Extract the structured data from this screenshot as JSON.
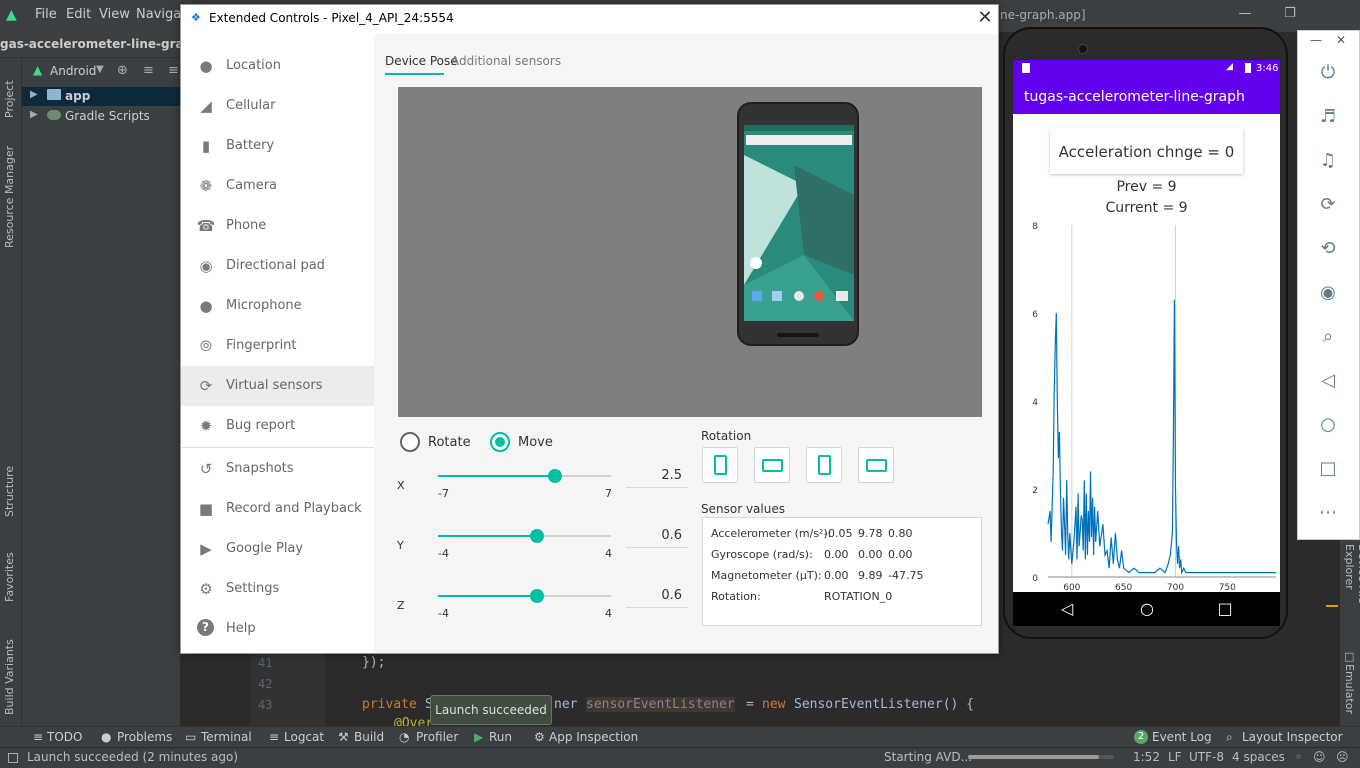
{
  "ide": {
    "menu": [
      "File",
      "Edit",
      "View",
      "Navigate"
    ],
    "title_right": "ne-graph.app]",
    "nav_title": "gas-accelerometer-line-graph",
    "project_view": "Android",
    "tree": [
      "app",
      "Gradle Scripts"
    ],
    "left_tabs": [
      "Project",
      "Resource Manager",
      "Structure",
      "Favorites",
      "Build Variants"
    ],
    "right_tabs": [
      "Device File Explorer",
      "Emulator"
    ],
    "line_numbers": [
      "41",
      "42",
      "43"
    ],
    "code": {
      "line41": "});",
      "line43_kw": "private",
      "line43_s": "S",
      "line43_type_rest": "ner",
      "line43_var": "sensorEventListener",
      "line43_eq": "=",
      "line43_new": "new",
      "line43_rest": "SensorEventListener() {",
      "line44": "@Over"
    },
    "bottom_tools": [
      "TODO",
      "Problems",
      "Terminal",
      "Logcat",
      "Build",
      "Profiler",
      "Run",
      "App Inspection"
    ],
    "bottom_right_tools": [
      "Event Log",
      "Layout Inspector"
    ],
    "event_log_count": "2",
    "tooltip": "Launch succeeded",
    "status_left": "Launch succeeded (2 minutes ago)",
    "status_starting": "Starting AVD...",
    "status_progress": 0.9,
    "status_position": "1:52",
    "status_line_sep": "LF",
    "status_encoding": "UTF-8",
    "status_indent": "4 spaces"
  },
  "extended_controls": {
    "title": "Extended Controls - Pixel_4_API_24:5554",
    "sidebar": [
      {
        "label": "Location",
        "icon": "location-pin-icon"
      },
      {
        "label": "Cellular",
        "icon": "signal-icon"
      },
      {
        "label": "Battery",
        "icon": "battery-icon"
      },
      {
        "label": "Camera",
        "icon": "camera-aperture-icon"
      },
      {
        "label": "Phone",
        "icon": "phone-icon"
      },
      {
        "label": "Directional pad",
        "icon": "dpad-icon"
      },
      {
        "label": "Microphone",
        "icon": "microphone-icon"
      },
      {
        "label": "Fingerprint",
        "icon": "fingerprint-icon"
      },
      {
        "label": "Virtual sensors",
        "icon": "rotate-sensor-icon",
        "active": true
      },
      {
        "label": "Bug report",
        "icon": "bug-icon"
      },
      {
        "label": "Snapshots",
        "icon": "history-icon"
      },
      {
        "label": "Record and Playback",
        "icon": "videocam-icon"
      },
      {
        "label": "Google Play",
        "icon": "play-icon"
      },
      {
        "label": "Settings",
        "icon": "gear-icon"
      },
      {
        "label": "Help",
        "icon": "help-icon"
      }
    ],
    "tabs": [
      "Device Pose",
      "Additional sensors"
    ],
    "mode": {
      "rotate": "Rotate",
      "move": "Move",
      "selected": "Move"
    },
    "sliders": [
      {
        "axis": "X",
        "min": "-7",
        "max": "7",
        "value": "2.5",
        "fraction": 0.679
      },
      {
        "axis": "Y",
        "min": "-4",
        "max": "4",
        "value": "0.6",
        "fraction": 0.575
      },
      {
        "axis": "Z",
        "min": "-4",
        "max": "4",
        "value": "0.6",
        "fraction": 0.575
      }
    ],
    "rotation_label": "Rotation",
    "sensor_values_title": "Sensor values",
    "sensors": [
      {
        "label": "Accelerometer (m/s²):",
        "values": [
          "-0.05",
          "9.78",
          "0.80"
        ]
      },
      {
        "label": "Gyroscope (rad/s):",
        "values": [
          "0.00",
          "0.00",
          "0.00"
        ]
      },
      {
        "label": "Magnetometer (µT):",
        "values": [
          "0.00",
          "9.89",
          "-47.75"
        ]
      },
      {
        "label": "Rotation:",
        "values": [
          "ROTATION_0"
        ]
      }
    ],
    "accent_color": "#00bfa5"
  },
  "emulator": {
    "time": "3:46",
    "app_title": "tugas-accelerometer-line-graph",
    "acceleration_text": "Acceleration chnge = 0",
    "prev_text": "Prev = 9",
    "current_text": "Current = 9",
    "app_bar_color": "#6200ee",
    "toolbar_icons": [
      "power-icon",
      "volume-up-icon",
      "volume-down-icon",
      "rotate-left-icon",
      "rotate-right-icon",
      "camera-icon",
      "zoom-icon",
      "back-icon",
      "home-icon",
      "overview-icon",
      "more-icon"
    ]
  },
  "chart_data": {
    "type": "line",
    "title": "",
    "xlabel": "",
    "ylabel": "",
    "xlim": [
      577,
      797
    ],
    "ylim": [
      0,
      8
    ],
    "x_ticks": [
      "600",
      "650",
      "700",
      "750"
    ],
    "y_ticks": [
      "0",
      "2",
      "4",
      "6",
      "8"
    ],
    "grid": "vertical at 600 and 700",
    "color": "#0072bc",
    "series": [
      {
        "x": [
          577,
          579,
          580,
          582,
          583,
          584,
          585,
          586,
          587,
          588,
          589,
          590,
          591,
          592,
          593,
          594,
          595,
          596,
          597,
          598,
          600,
          602,
          604,
          605,
          606,
          607,
          608,
          609,
          610,
          611,
          612,
          613,
          614,
          615,
          616,
          617,
          618,
          619,
          620,
          621,
          622,
          623,
          625,
          627,
          630,
          632,
          634,
          636,
          638,
          640,
          642,
          644,
          646,
          648,
          650,
          655,
          660,
          665,
          670,
          675,
          680,
          685,
          690,
          693,
          695,
          697,
          698,
          699,
          700,
          701,
          702,
          703,
          704,
          705,
          706,
          708,
          710,
          715,
          720,
          725,
          730,
          740,
          750,
          760,
          770,
          780,
          790,
          797
        ],
        "y": [
          1.2,
          1.5,
          0.8,
          2.4,
          4.2,
          5.3,
          6.0,
          4.0,
          2.7,
          3.3,
          2.0,
          1.0,
          0.6,
          1.8,
          1.2,
          0.5,
          2.2,
          1.0,
          0.4,
          1.0,
          0.3,
          0.8,
          1.6,
          0.4,
          1.9,
          0.7,
          1.0,
          1.4,
          1.3,
          0.6,
          2.2,
          0.4,
          1.9,
          0.5,
          1.5,
          0.8,
          2.4,
          0.9,
          1.8,
          0.5,
          1.6,
          0.8,
          1.5,
          0.7,
          1.2,
          0.5,
          0.6,
          0.2,
          0.9,
          0.3,
          1.0,
          0.4,
          0.2,
          0.6,
          0.2,
          0.1,
          0.2,
          0.1,
          0.1,
          0.1,
          0.1,
          0.2,
          0.1,
          0.3,
          0.5,
          1.0,
          3.2,
          6.3,
          2.0,
          0.8,
          0.3,
          0.7,
          0.2,
          0.4,
          0.1,
          0.2,
          0.1,
          0.1,
          0.1,
          0.1,
          0.1,
          0.1,
          0.1,
          0.1,
          0.1,
          0.1,
          0.1,
          0.1
        ]
      }
    ]
  }
}
